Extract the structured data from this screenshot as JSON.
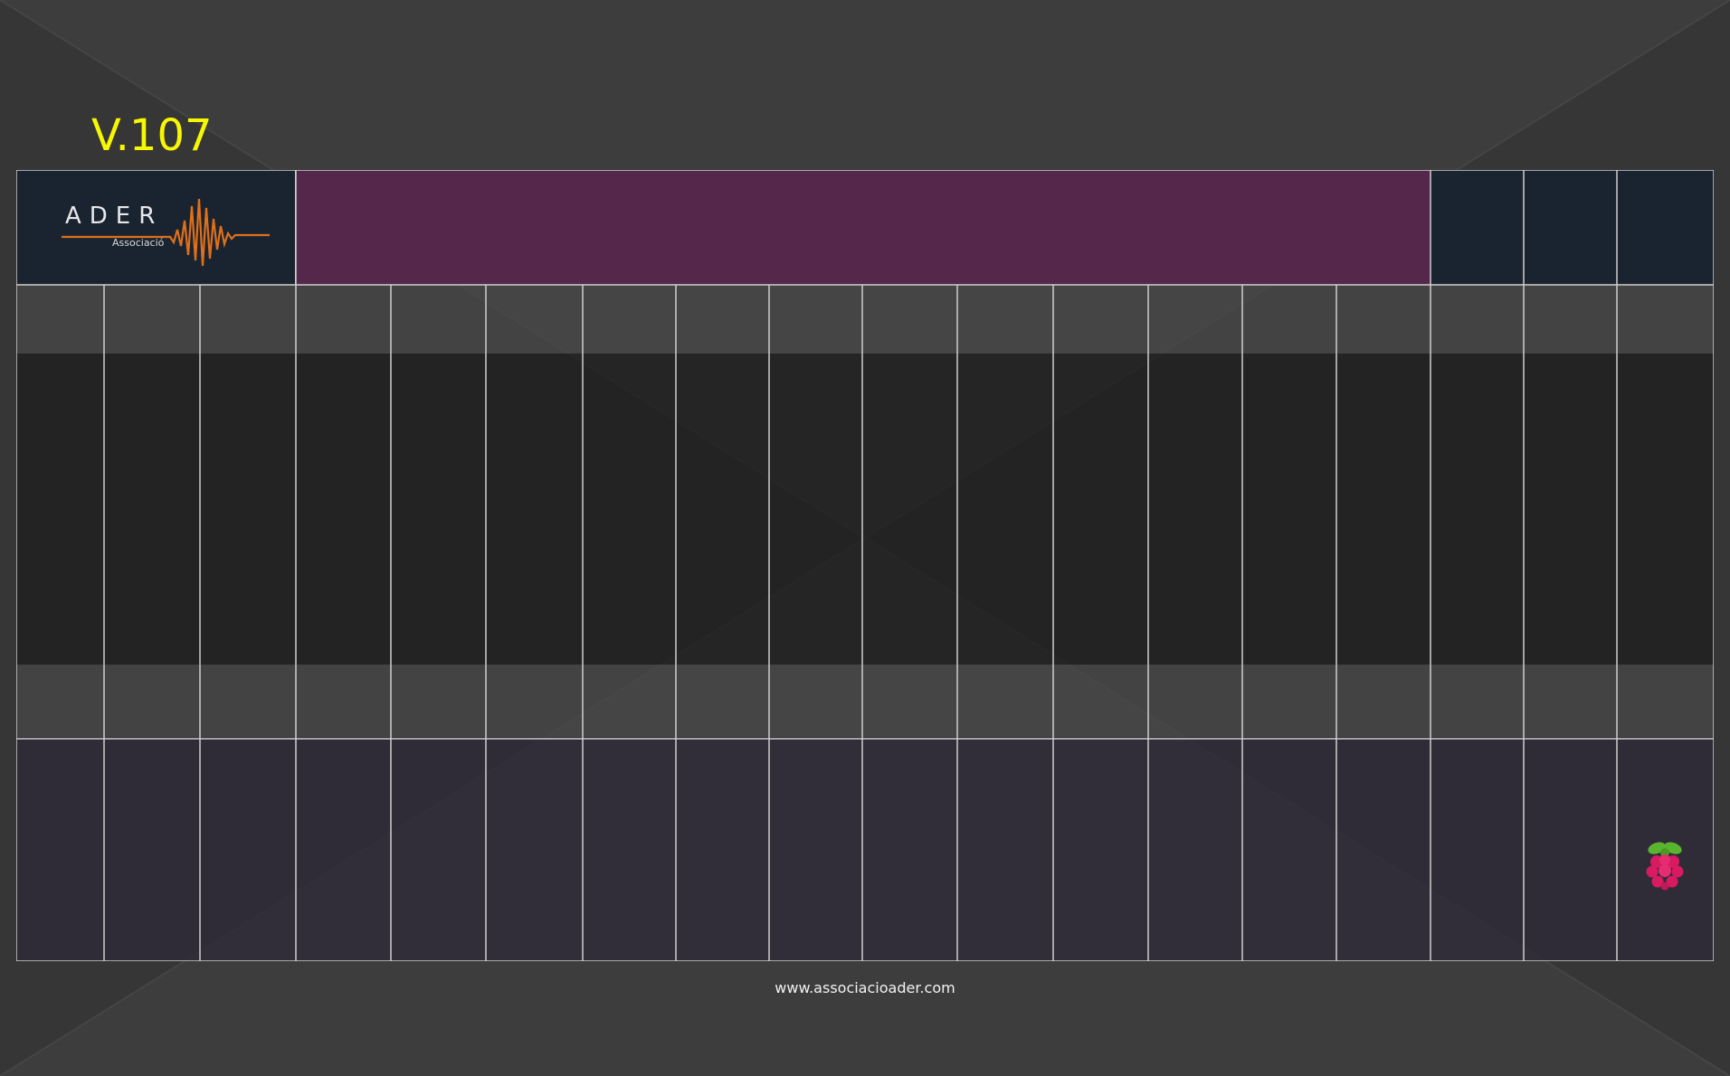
{
  "version": "V.107",
  "logo": {
    "name": "ADER",
    "sub": "Associació"
  },
  "footer": {
    "url": "www.associacioader.com"
  },
  "icons": {
    "raspberry": "raspberry-pi-icon",
    "logo_wave": "waveform-icon"
  },
  "colors": {
    "background": "#3a3a3a",
    "version_text": "#f7f700",
    "header_title": "#54274b",
    "header_dark": "#1a2430",
    "logo_wave": "#e0701a",
    "grid_line": "#cfcfcf",
    "raspberry_body": "#d81b60",
    "raspberry_leaf": "#5ab52e"
  }
}
